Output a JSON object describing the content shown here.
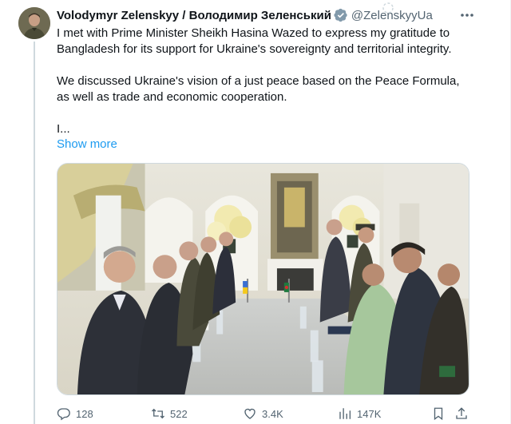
{
  "author": {
    "display_name": "Volodymyr Zelenskyy / Володимир Зеленський",
    "handle": "@ZelenskyyUa"
  },
  "tweet": {
    "paragraphs": [
      "I met with Prime Minister Sheikh Hasina Wazed to express my gratitude to Bangladesh for its support for Ukraine's sovereignty and territorial integrity.",
      "We discussed Ukraine's vision of a just peace based on the Peace Formula, as well as trade and economic cooperation.",
      "I..."
    ],
    "show_more": "Show more"
  },
  "actions": {
    "replies": "128",
    "reposts": "522",
    "likes": "3.4K",
    "views": "147K"
  },
  "icons": {
    "verified": "verified-badge-icon",
    "loading": "loading-spinner-icon",
    "more": "more-options-icon",
    "reply": "reply-icon",
    "repost": "repost-icon",
    "like": "heart-icon",
    "views": "views-chart-icon",
    "bookmark": "bookmark-icon",
    "share": "share-icon"
  },
  "colors": {
    "accent": "#1d9bf0",
    "secondary_text": "#536471",
    "text": "#0f1419"
  }
}
